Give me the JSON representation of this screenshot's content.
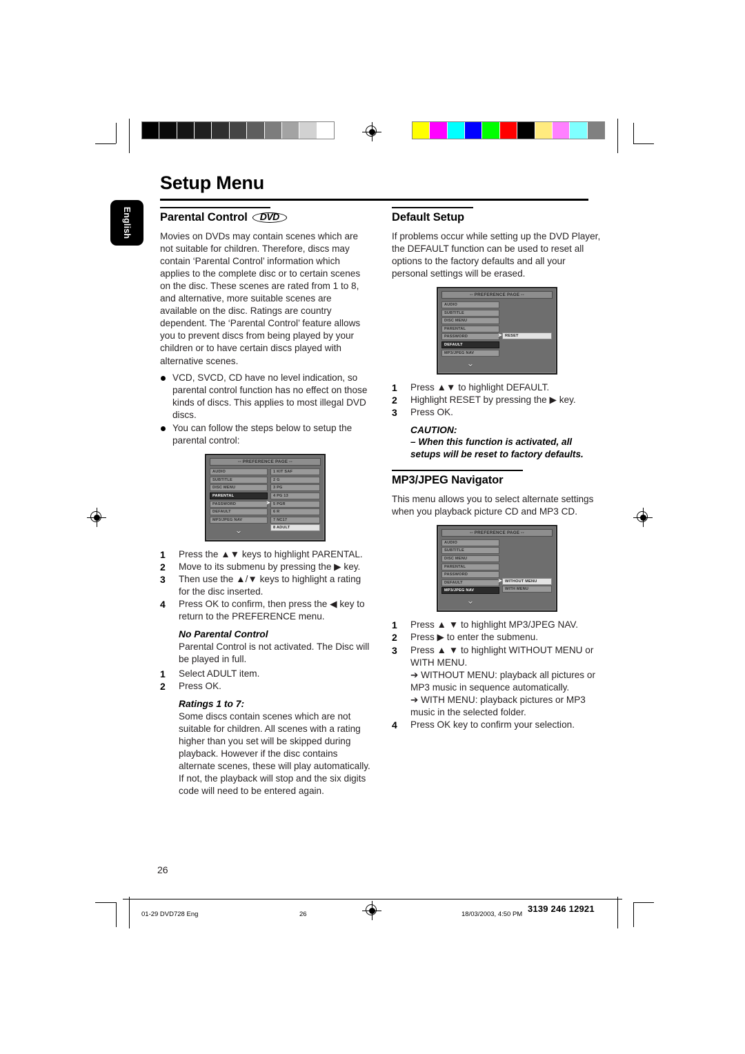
{
  "page": {
    "title": "Setup Menu",
    "language_tab": "English",
    "page_number": "26"
  },
  "colorbars": {
    "grayscale": [
      "#000000",
      "#0a0a0a",
      "#151515",
      "#202020",
      "#303030",
      "#454545",
      "#5e5e5e",
      "#7d7d7d",
      "#a3a3a3",
      "#d2d2d2",
      "#ffffff"
    ],
    "colors": [
      "#ffff00",
      "#ff00ff",
      "#00ffff",
      "#0000ff",
      "#00ff00",
      "#ff0000",
      "#000000",
      "#ffeb7f",
      "#ff7fff",
      "#7fffff",
      "#808080"
    ]
  },
  "left_column": {
    "heading": "Parental Control",
    "heading_logo": "DVD",
    "intro": "Movies on DVDs may contain scenes which are not suitable for children. Therefore, discs may contain ‘Parental Control’ information which applies to the complete disc or to certain scenes on the disc. These scenes are rated from 1 to 8, and alternative, more suitable scenes are available on the disc. Ratings are country dependent. The ‘Parental Control’ feature allows you to prevent discs from being played by your children or to have certain discs played with alternative scenes.",
    "bullets": [
      "VCD, SVCD, CD have no level indication, so parental control function has no effect on those kinds of discs. This applies to most illegal DVD discs.",
      "You can follow the steps below to setup the parental control:"
    ],
    "osd": {
      "title": "-- PREFERENCE PAGE --",
      "menu_items": [
        "AUDIO",
        "SUBTITLE",
        "DISC MENU",
        "PARENTAL",
        "PASSWORD",
        "DEFAULT",
        "MP3/JPEG NAV"
      ],
      "selected_item": "PARENTAL",
      "submenu_items": [
        "1 KIT SAF",
        "2 G",
        "3 PG",
        "4 PG 13",
        "5 PGR",
        "6 R",
        "7 NC17",
        "8 ADULT"
      ],
      "highlighted_submenu": "8 ADULT",
      "scroll_icon": "chevron-down"
    },
    "steps": [
      "Press the ▲▼ keys to highlight PARENTAL.",
      "Move to its submenu by pressing the ▶ key.",
      "Then use the ▲/▼ keys to highlight a rating for the disc inserted.",
      "Press OK to confirm, then press the ◀ key to return to the PREFERENCE menu."
    ],
    "no_parental": {
      "heading": "No Parental Control",
      "body": "Parental Control is not activated. The Disc will be played in full.",
      "steps": [
        "Select ADULT item.",
        "Press OK."
      ]
    },
    "ratings": {
      "heading": "Ratings 1 to 7:",
      "body": "Some discs contain scenes which are not suitable for children. All scenes with a rating higher than you set will be skipped during playback. However if the disc contains alternate scenes, these will play automatically. If not, the playback will stop and the six digits code will need to be entered again."
    }
  },
  "right_column": {
    "default_setup": {
      "heading": "Default Setup",
      "body": "If problems occur while setting up the DVD Player, the DEFAULT function can be used to reset all options to the factory defaults and all your personal settings will be erased.",
      "osd": {
        "title": "-- PREFERENCE PAGE --",
        "menu_items": [
          "AUDIO",
          "SUBTITLE",
          "DISC MENU",
          "PARENTAL",
          "PASSWORD",
          "DEFAULT",
          "MP3/JPEG NAV"
        ],
        "selected_item": "DEFAULT",
        "submenu_items": [
          "RESET"
        ],
        "scroll_icon": "chevron-down"
      },
      "steps": [
        "Press ▲▼ to highlight DEFAULT.",
        "Highlight RESET by pressing the ▶ key.",
        "Press OK."
      ],
      "caution_heading": "CAUTION:",
      "caution_body": "– When this function is activated, all setups will be reset to factory defaults."
    },
    "mp3_navigator": {
      "heading": "MP3/JPEG Navigator",
      "body": "This menu allows you to select alternate settings when you playback picture CD and MP3 CD.",
      "osd": {
        "title": "-- PREFERENCE PAGE --",
        "menu_items": [
          "AUDIO",
          "SUBTITLE",
          "DISC MENU",
          "PARENTAL",
          "PASSWORD",
          "DEFAULT",
          "MP3/JPEG NAV"
        ],
        "selected_item": "MP3/JPEG NAV",
        "submenu_items": [
          "WITHOUT MENU",
          "WITH MENU"
        ],
        "highlighted_submenu": "WITHOUT MENU",
        "scroll_icon": "chevron-down"
      },
      "steps": [
        "Press ▲ ▼ to highlight MP3/JPEG NAV.",
        "Press ▶ to enter the submenu.",
        "Press ▲ ▼ to highlight WITHOUT MENU or WITH MENU."
      ],
      "notes": [
        "➔ WITHOUT MENU:  playback all pictures or MP3 music in sequence automatically.",
        "➔ WITH MENU: playback pictures or MP3 music in the selected folder."
      ],
      "final_step": "Press OK key to confirm your selection.",
      "final_step_number": "4"
    }
  },
  "footer": {
    "file_label": "01-29 DVD728 Eng",
    "page_number": "26",
    "timestamp": "18/03/2003, 4:50 PM",
    "doc_code": "3139 246 12921"
  }
}
